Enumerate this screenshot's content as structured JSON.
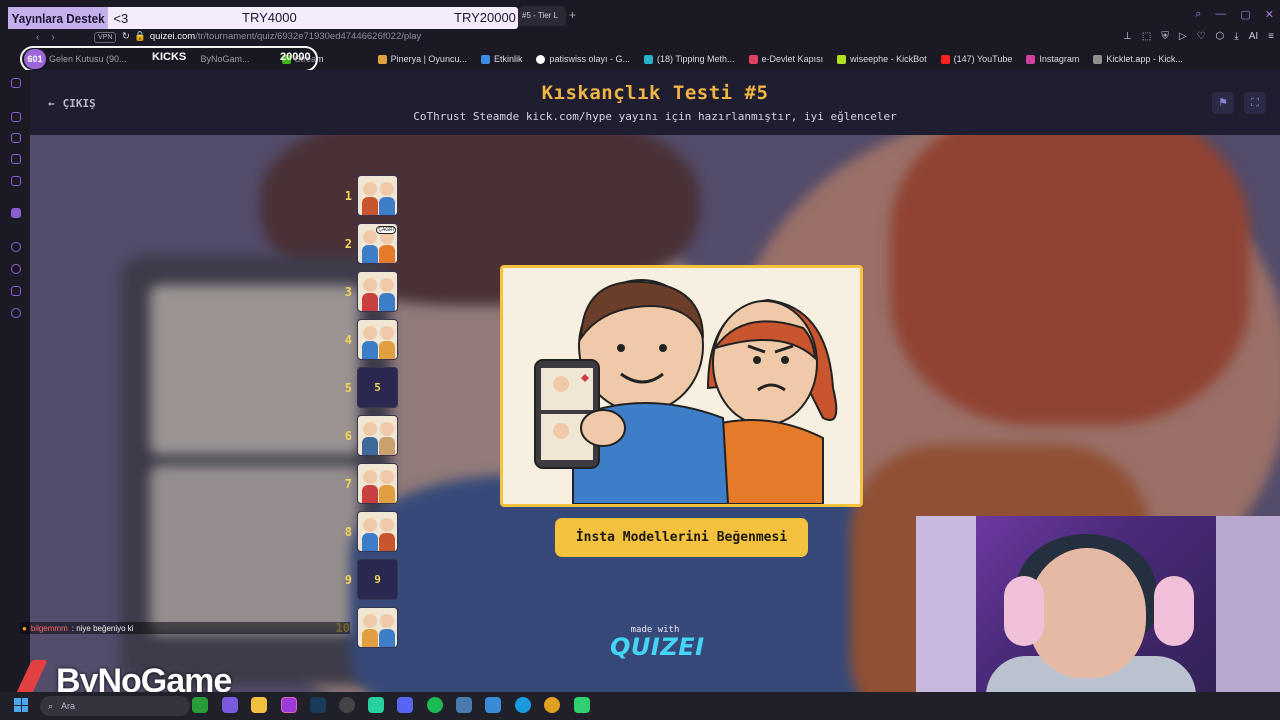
{
  "browser": {
    "active_tab": "#5 - Tier L",
    "vpn": "VPN",
    "url_host": "quizei.com",
    "url_path": "/tr/tournament/quiz/6932e71930ed47446626f022/play",
    "right_tool_ai": "AI",
    "bookmarks": [
      "Gelen Kutusu (90...",
      "ByNoGam...",
      "Stream",
      "Pinerya | Oyuncu...",
      "Etkinlik",
      "patiswiss olayı - G...",
      "(18) Tipping Meth...",
      "e-Devlet Kapısı",
      "wiseephe - KickBot",
      "(147) YouTube",
      "Instagram",
      "Kicklet.app - Kick..."
    ]
  },
  "donation_bar": {
    "label": "Yayınlara Destek",
    "heart": "<3",
    "goal_1": "TRY4000",
    "goal_2": "TRY20000"
  },
  "kicks_overlay": {
    "badge": "601",
    "label": "KICKS",
    "value": "20000"
  },
  "page": {
    "exit_label": "ÇIKIŞ",
    "title": "Kıskançlık Testi #5",
    "subtitle": "CoThrust Steamde kick.com/hype yayını için hazırlanmıştır, iyi eğlenceler"
  },
  "list": [
    {
      "num": "1",
      "filled": true
    },
    {
      "num": "2",
      "filled": true,
      "tag": "ÇAĞRI"
    },
    {
      "num": "3",
      "filled": true
    },
    {
      "num": "4",
      "filled": true
    },
    {
      "num": "5",
      "filled": false
    },
    {
      "num": "6",
      "filled": true
    },
    {
      "num": "7",
      "filled": true
    },
    {
      "num": "8",
      "filled": true
    },
    {
      "num": "9",
      "filled": false
    },
    {
      "num": "10",
      "filled": true
    }
  ],
  "current_card": {
    "caption": "İnsta Modellerini Beğenmesi"
  },
  "footer": {
    "made_with": "made with",
    "brand": "QUIZEI"
  },
  "chat": {
    "username": "bilgemmm",
    "message": ": niye beğeniyo ki"
  },
  "streamer_logo": "ByNoGame",
  "taskbar": {
    "search_placeholder": "Ara"
  },
  "colors": {
    "accent_yellow": "#f4c23e",
    "header_bg": "#1f1e30",
    "title_color": "#f2b544",
    "brand_cyan": "#44d4f4"
  }
}
